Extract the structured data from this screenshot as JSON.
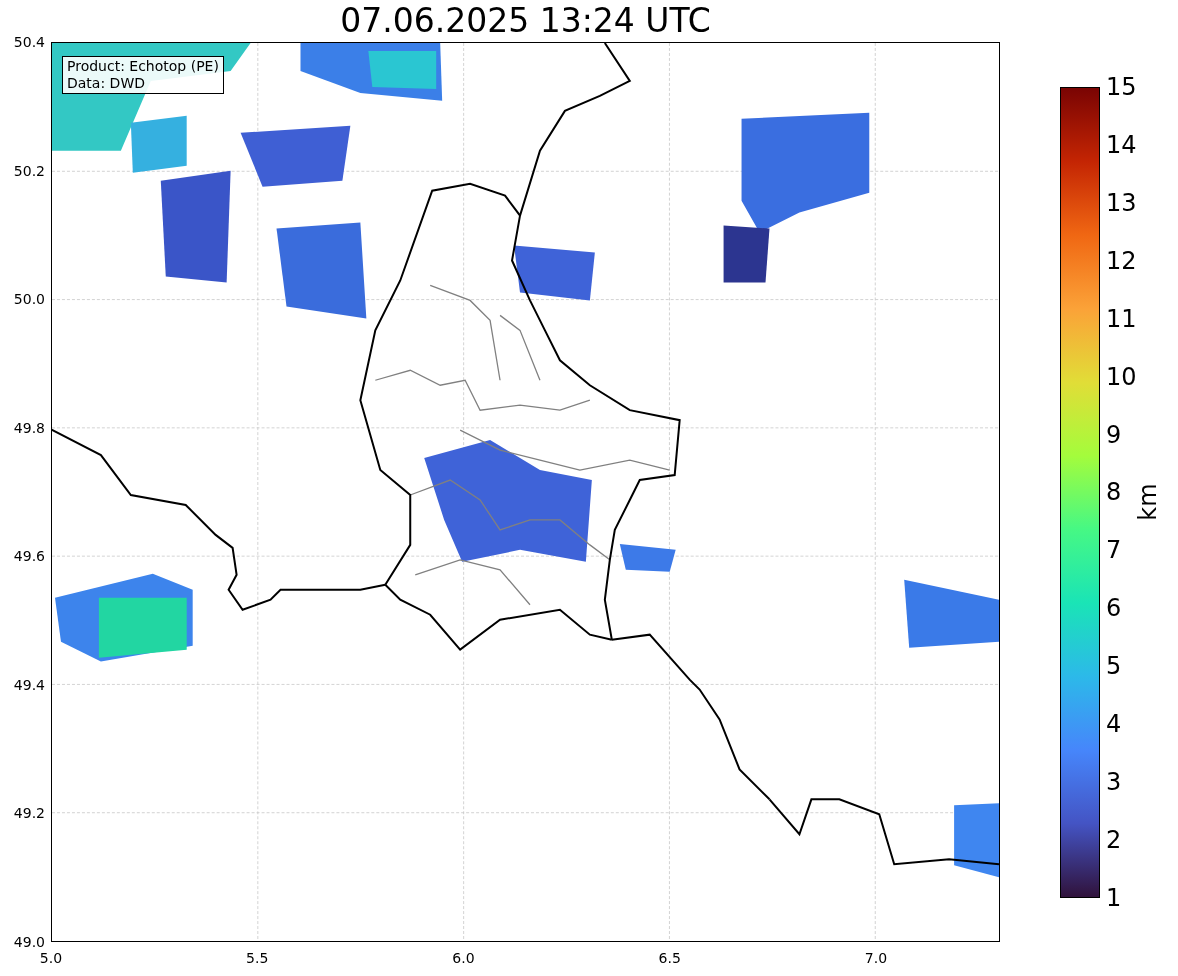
{
  "title": "07.06.2025 13:24 UTC",
  "info_box": {
    "lines": [
      "Product: Echotop (PE)",
      "Data: DWD"
    ]
  },
  "map": {
    "y_axis_labels": [
      "50.4",
      "50.2",
      "50.0",
      "49.8",
      "49.6",
      "49.4",
      "49.2",
      "49.0"
    ],
    "x_axis_labels": [
      "5.0",
      "5.5",
      "6.0",
      "6.5",
      "7.0"
    ]
  },
  "colorbar": {
    "label": "km",
    "tick_labels": [
      "15",
      "14",
      "13",
      "12",
      "11",
      "10",
      "9",
      "8",
      "7",
      "6",
      "5",
      "4",
      "3",
      "2",
      "1"
    ]
  }
}
